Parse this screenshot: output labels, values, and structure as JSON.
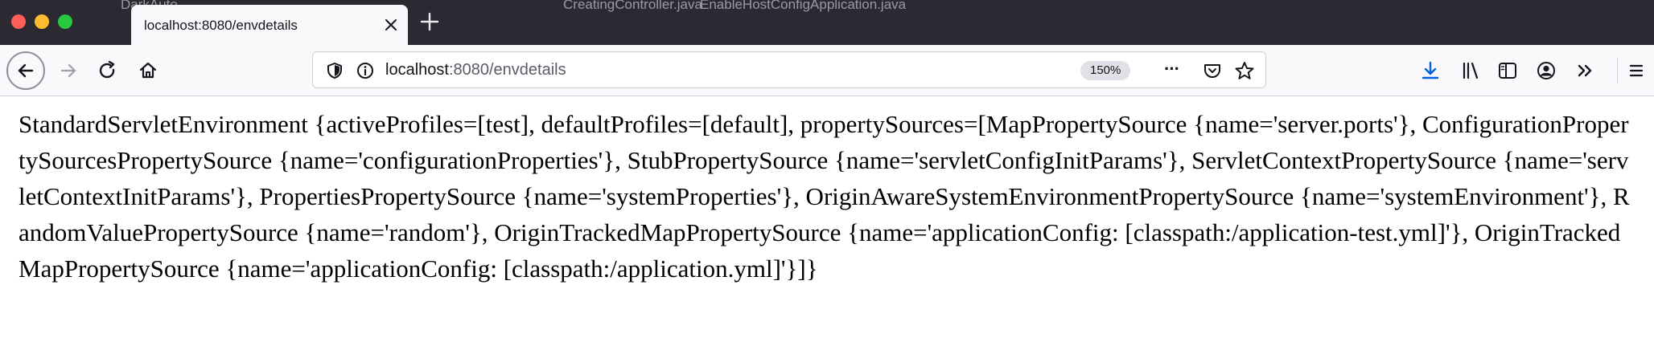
{
  "window": {
    "background_tab_texts": [
      "DarkAuto",
      "CreatingController.java",
      "EnableHostConfigApplication.java"
    ]
  },
  "tab": {
    "title": "localhost:8080/envdetails"
  },
  "toolbar": {
    "url_host": "localhost",
    "url_path": ":8080/envdetails",
    "zoom": "150%",
    "more_label": "···"
  },
  "page": {
    "body_text": "StandardServletEnvironment {activeProfiles=[test], defaultProfiles=[default], propertySources=[MapPropertySource {name='server.ports'}, ConfigurationPropertySourcesPropertySource {name='configurationProperties'}, StubPropertySource {name='servletConfigInitParams'}, ServletContextPropertySource {name='servletContextInitParams'}, PropertiesPropertySource {name='systemProperties'}, OriginAwareSystemEnvironmentPropertySource {name='systemEnvironment'}, RandomValuePropertySource {name='random'}, OriginTrackedMapPropertySource {name='applicationConfig: [classpath:/application-test.yml]'}, OriginTrackedMapPropertySource {name='applicationConfig: [classpath:/application.yml]'}]}"
  },
  "icons": [
    "close-window",
    "minimize-window",
    "maximize-window",
    "tab-close-icon",
    "plus-icon",
    "back-arrow-icon",
    "forward-arrow-icon",
    "reload-icon",
    "home-icon",
    "shield-icon",
    "info-icon",
    "pocket-icon",
    "star-icon",
    "download-icon",
    "library-icon",
    "sidebar-icon",
    "account-icon",
    "chevron-double-right-icon",
    "hamburger-menu-icon"
  ],
  "colors": {
    "titlebar": "#2b2a33",
    "toolbar": "#f9f9fb",
    "download_accent": "#0061e0"
  }
}
